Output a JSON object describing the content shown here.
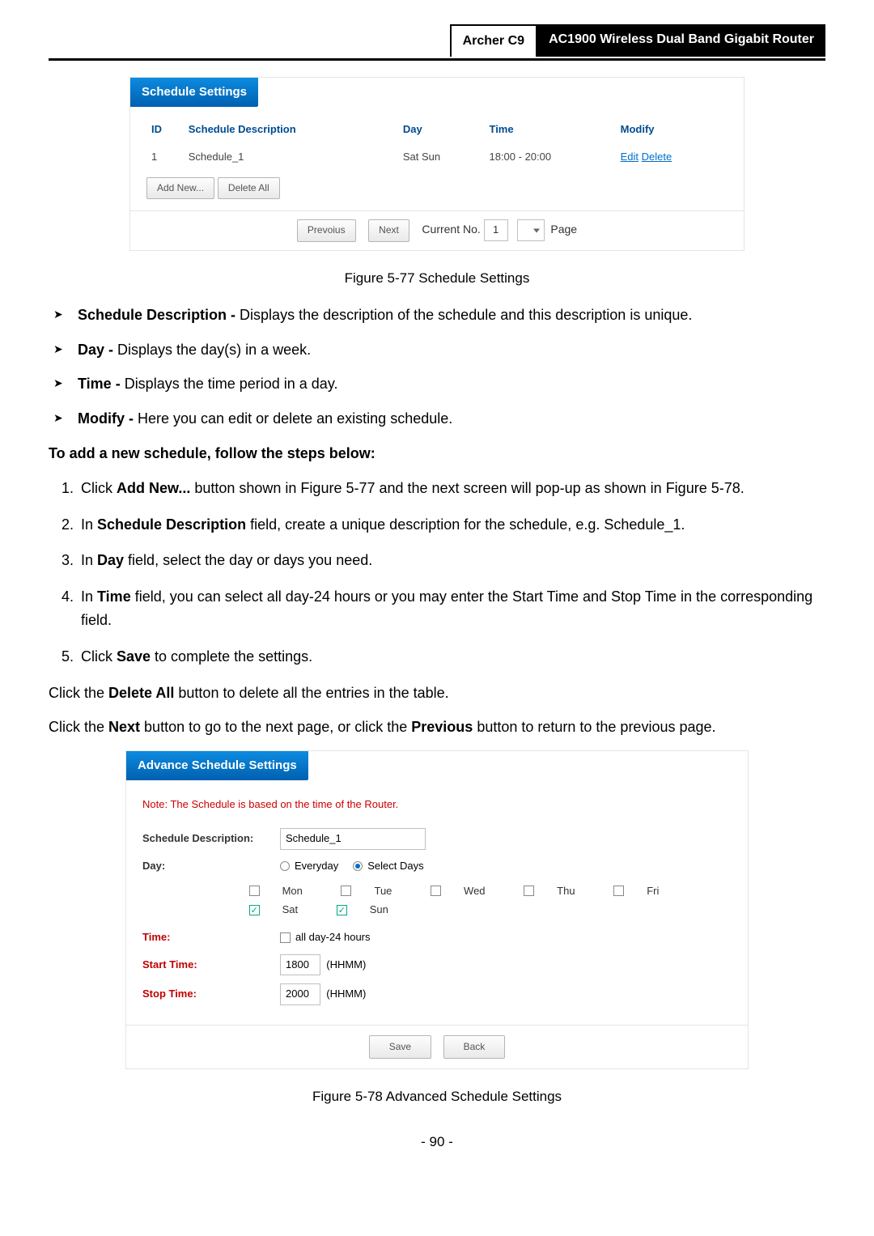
{
  "header": {
    "model": "Archer C9",
    "product": "AC1900 Wireless Dual Band Gigabit Router"
  },
  "schedule_panel": {
    "title": "Schedule Settings",
    "columns": {
      "id": "ID",
      "desc": "Schedule Description",
      "day": "Day",
      "time": "Time",
      "modify": "Modify"
    },
    "row": {
      "id": "1",
      "desc": "Schedule_1",
      "day": "Sat Sun",
      "time": "18:00 - 20:00",
      "edit": "Edit",
      "del": "Delete"
    },
    "add_btn": "Add New...",
    "delete_all_btn": "Delete All",
    "prev_btn": "Prevoius",
    "next_btn": "Next",
    "current_no_label": "Current No.",
    "current_no_value": "1",
    "page_label": "Page"
  },
  "fig1_caption": "Figure 5-77 Schedule Settings",
  "bullets": {
    "b1_label": "Schedule Description -",
    "b1_text": " Displays the description of the schedule and this description is unique.",
    "b2_label": "Day -",
    "b2_text": " Displays the day(s) in a week.",
    "b3_label": "Time -",
    "b3_text": " Displays the time period in a day.",
    "b4_label": "Modify -",
    "b4_text": " Here you can edit or delete an existing schedule."
  },
  "steps_heading": "To add a new schedule, follow the steps below:",
  "steps": {
    "s1a": "Click ",
    "s1b": "Add New...",
    "s1c": " button shown in Figure 5-77 and the next screen will pop-up as shown in Figure 5-78.",
    "s2a": "In ",
    "s2b": "Schedule Description",
    "s2c": " field, create a unique description for the schedule, e.g. Schedule_1.",
    "s3a": "In ",
    "s3b": "Day",
    "s3c": " field, select the day or days you need.",
    "s4a": "In ",
    "s4b": "Time",
    "s4c": " field, you can select all day-24 hours or you may enter the Start Time and Stop Time in the corresponding field.",
    "s5a": "Click ",
    "s5b": "Save",
    "s5c": " to complete the settings."
  },
  "p_delete_a": "Click the ",
  "p_delete_b": "Delete All",
  "p_delete_c": " button to delete all the entries in the table.",
  "p_next_a": "Click the ",
  "p_next_b": "Next",
  "p_next_c": " button to go to the next page, or click the ",
  "p_next_d": "Previous",
  "p_next_e": " button to return to the previous page.",
  "adv_panel": {
    "title": "Advance Schedule Settings",
    "note": "Note: The Schedule is based on the time of the Router.",
    "labels": {
      "desc": "Schedule Description:",
      "day": "Day:",
      "time": "Time:",
      "start": "Start Time:",
      "stop": "Stop Time:"
    },
    "desc_value": "Schedule_1",
    "opt_everyday": "Everyday",
    "opt_selectdays": "Select Days",
    "days": {
      "mon": "Mon",
      "tue": "Tue",
      "wed": "Wed",
      "thu": "Thu",
      "fri": "Fri",
      "sat": "Sat",
      "sun": "Sun"
    },
    "allday": "all day-24 hours",
    "start_value": "1800",
    "stop_value": "2000",
    "hhmm": "(HHMM)",
    "save_btn": "Save",
    "back_btn": "Back"
  },
  "fig2_caption": "Figure 5-78 Advanced Schedule Settings",
  "page_number": "- 90 -"
}
